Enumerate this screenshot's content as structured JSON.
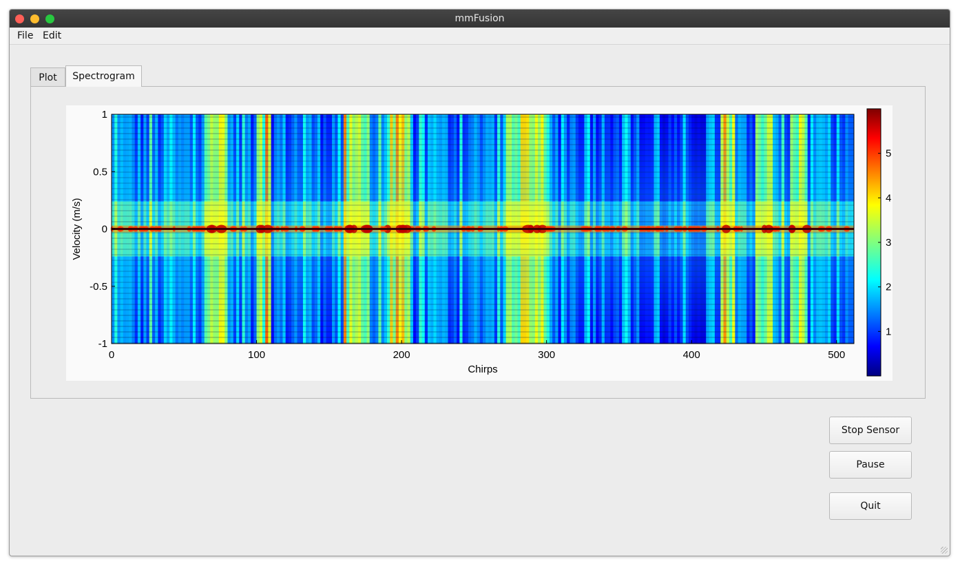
{
  "window": {
    "title": "mmFusion"
  },
  "menu": {
    "file": "File",
    "edit": "Edit"
  },
  "tabs": {
    "plot": "Plot",
    "spectrogram": "Spectrogram"
  },
  "buttons": {
    "stop_sensor": "Stop Sensor",
    "pause": "Pause",
    "quit": "Quit"
  },
  "chart_data": {
    "type": "heatmap",
    "title": "",
    "xlabel": "Chirps",
    "ylabel": "Velocity (m/s)",
    "xlim": [
      0,
      512
    ],
    "ylim": [
      -1,
      1
    ],
    "x_ticks": [
      "0",
      "100",
      "200",
      "300",
      "400",
      "500"
    ],
    "x_tick_values": [
      0,
      100,
      200,
      300,
      400,
      500
    ],
    "y_ticks": [
      "1",
      "0.5",
      "0",
      "-0.5",
      "-1"
    ],
    "y_tick_values": [
      1,
      0.5,
      0,
      -0.5,
      -1
    ],
    "colorbar": {
      "colormap": "jet",
      "range": [
        0,
        6
      ],
      "ticks": [
        "1",
        "2",
        "3",
        "4",
        "5"
      ],
      "tick_values": [
        1,
        2,
        3,
        4,
        5
      ]
    },
    "bright_bands_chirps": [
      [
        160,
        178
      ],
      [
        190,
        205
      ],
      [
        272,
        300
      ],
      [
        64,
        80
      ],
      [
        100,
        110
      ],
      [
        420,
        430
      ],
      [
        445,
        455
      ],
      [
        468,
        480
      ]
    ],
    "peak_values_at_zero_velocity": 5.8
  }
}
